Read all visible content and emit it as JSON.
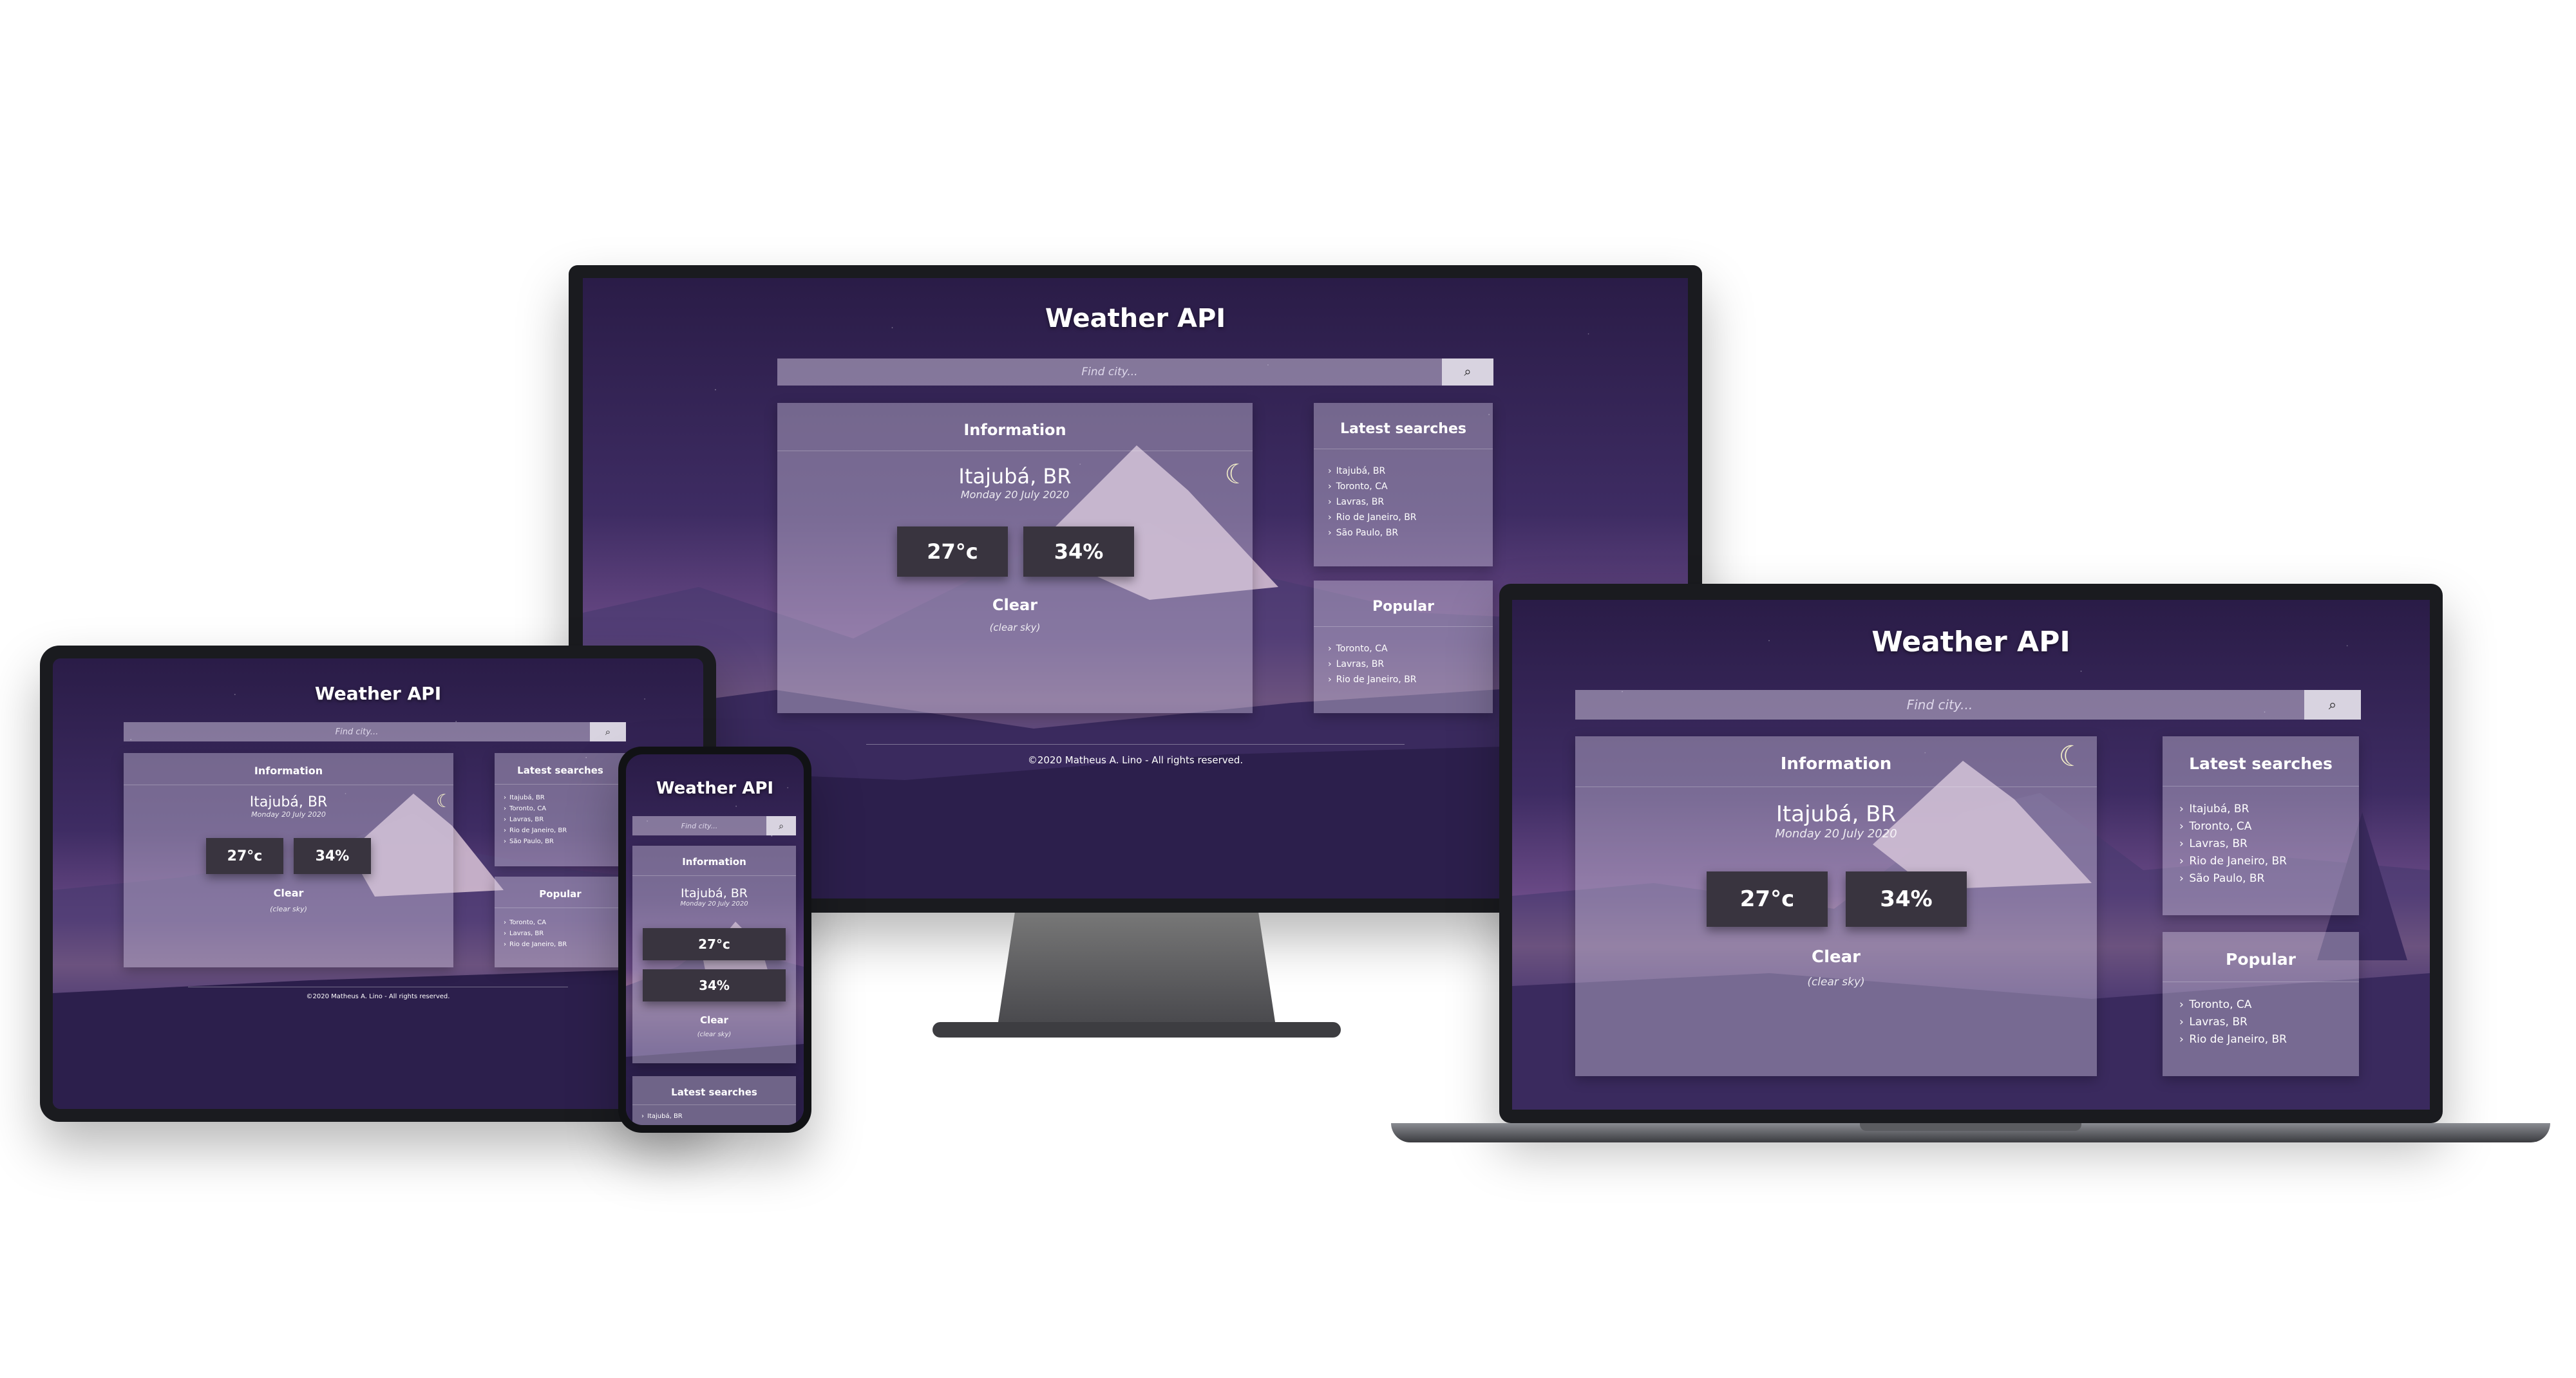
{
  "app": {
    "title": "Weather API",
    "search_placeholder": "Find city...",
    "info_title": "Information",
    "city": "Itajubá, BR",
    "date": "Monday 20 July 2020",
    "temperature": "27°c",
    "humidity": "34%",
    "condition": "Clear",
    "condition_desc": "(clear sky)",
    "latest_title": "Latest searches",
    "latest": [
      "Itajubá, BR",
      "Toronto, CA",
      "Lavras, BR",
      "Rio de Janeiro, BR",
      "São Paulo, BR"
    ],
    "popular_title": "Popular",
    "popular": [
      "Toronto, CA",
      "Lavras, BR",
      "Rio de Janeiro, BR"
    ],
    "footer": "©2020 Matheus A. Lino - All rights reserved.",
    "phone_latest_first": "Itajubá, BR"
  },
  "icons": {
    "search": "search-icon",
    "moon": "moon-icon"
  },
  "colors": {
    "stat_bg": "#39343f",
    "panel": "#cdc3dc",
    "bezel": "#1a1b1f"
  }
}
